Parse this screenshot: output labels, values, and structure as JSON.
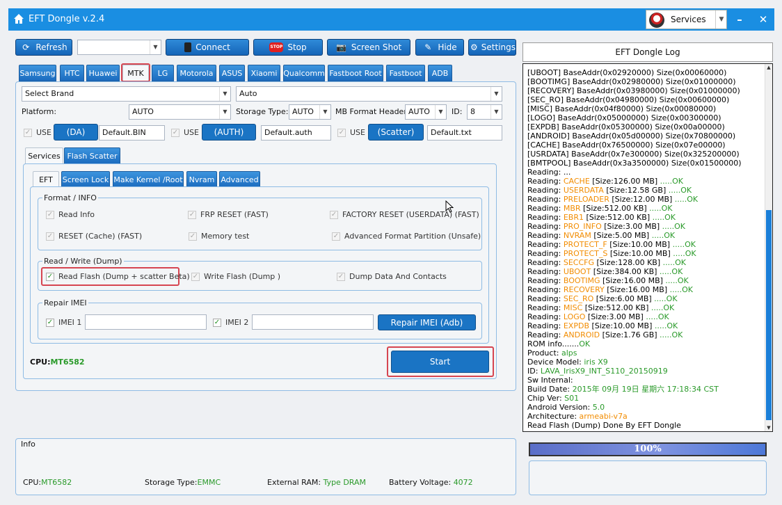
{
  "app": {
    "title": "EFT Dongle  v.2.4",
    "services_label": "Services"
  },
  "toolbar": {
    "refresh": "Refresh",
    "connect": "Connect",
    "stop": "Stop",
    "stop_badge": "STOP",
    "screenshot": "Screen Shot",
    "hide": "Hide",
    "settings": "Settings",
    "device_combo_value": ""
  },
  "brand_tabs": [
    "Samsung",
    "HTC",
    "Huawei",
    "MTK",
    "LG",
    "Motorola",
    "ASUS",
    "Xiaomi",
    "Qualcomm",
    "Fastboot Root",
    "Fastboot",
    "ADB"
  ],
  "brand_tab_selected": "MTK",
  "brand_select": "Select Brand",
  "auto_select": "Auto",
  "platform": {
    "label": "Platform:",
    "value": "AUTO"
  },
  "storage": {
    "label": "Storage Type:",
    "value": "AUTO"
  },
  "mb_format": {
    "label": "MB Format Header",
    "value": "AUTO"
  },
  "id": {
    "label": "ID:",
    "value": "8"
  },
  "use_rows": [
    {
      "use": "USE",
      "btn": "(DA)",
      "file": "Default.BIN"
    },
    {
      "use": "USE",
      "btn": "(AUTH)",
      "file": "Default.auth"
    },
    {
      "use": "USE",
      "btn": "(Scatter)",
      "file": "Default.txt"
    }
  ],
  "sub_tabs": [
    "Services",
    "Flash Scatter"
  ],
  "inner_tabs": [
    "EFT",
    "Screen Lock",
    "Make Kernel  /Root",
    "Nvram",
    "Advanced"
  ],
  "format_info": {
    "title": "Format / INFO",
    "items": [
      "Read Info",
      "FRP RESET (FAST)",
      "FACTORY RESET (USERDATA) (FAST)",
      "RESET (Cache) (FAST)",
      "Memory test",
      "Advanced Format Partition (Unsafe)"
    ]
  },
  "read_write": {
    "title": "Read / Write (Dump)",
    "items": [
      "Read Flash (Dump + scatter Beta)",
      "Write Flash (Dump )",
      "Dump Data And Contacts"
    ]
  },
  "repair_imei": {
    "title": "Repair IMEI",
    "imei1": "IMEI 1",
    "imei2": "IMEI 2",
    "imei1_value": "",
    "imei2_value": "",
    "button": "Repair IMEI (Adb)"
  },
  "cpu": {
    "label": "CPU:",
    "value": "MT6582"
  },
  "start_label": "Start",
  "info": {
    "title": "Info",
    "cpu_label": "CPU:",
    "cpu_value": "MT6582",
    "storage_label": "Storage Type:",
    "storage_value": "EMMC",
    "ram_label": "External RAM: ",
    "ram_value": "Type DRAM",
    "battery_label": "Battery Voltage: ",
    "battery_value": "4072"
  },
  "log": {
    "title": "EFT Dongle Log",
    "lines": [
      [
        {
          "t": "[UBOOT] BaseAddr(0x02920000) Size(0x00060000)",
          "c": ""
        }
      ],
      [
        {
          "t": "[BOOTIMG] BaseAddr(0x02980000) Size(0x01000000)",
          "c": ""
        }
      ],
      [
        {
          "t": "[RECOVERY] BaseAddr(0x03980000) Size(0x01000000)",
          "c": ""
        }
      ],
      [
        {
          "t": "[SEC_RO] BaseAddr(0x04980000) Size(0x00600000)",
          "c": ""
        }
      ],
      [
        {
          "t": "[MISC] BaseAddr(0x04f80000) Size(0x00080000)",
          "c": ""
        }
      ],
      [
        {
          "t": "[LOGO] BaseAddr(0x05000000) Size(0x00300000)",
          "c": ""
        }
      ],
      [
        {
          "t": "[EXPDB] BaseAddr(0x05300000) Size(0x00a00000)",
          "c": ""
        }
      ],
      [
        {
          "t": "[ANDROID] BaseAddr(0x05d00000) Size(0x70800000)",
          "c": ""
        }
      ],
      [
        {
          "t": "[CACHE] BaseAddr(0x76500000) Size(0x07e00000)",
          "c": ""
        }
      ],
      [
        {
          "t": "[USRDATA] BaseAddr(0x7e300000) Size(0x325200000)",
          "c": ""
        }
      ],
      [
        {
          "t": "[BMTPOOL] BaseAddr(0x3a3500000) Size(0x01500000)",
          "c": ""
        }
      ],
      [
        {
          "t": "Reading: ...",
          "c": ""
        }
      ],
      [
        {
          "t": "Reading: ",
          "c": ""
        },
        {
          "t": "CACHE",
          "c": "o"
        },
        {
          "t": " [Size:126.00 MB]",
          "c": ""
        },
        {
          "t": " .....OK",
          "c": "g"
        }
      ],
      [
        {
          "t": "Reading: ",
          "c": ""
        },
        {
          "t": "USERDATA",
          "c": "o"
        },
        {
          "t": " [Size:12.58 GB]",
          "c": ""
        },
        {
          "t": " .....OK",
          "c": "g"
        }
      ],
      [
        {
          "t": "Reading: ",
          "c": ""
        },
        {
          "t": "PRELOADER",
          "c": "o"
        },
        {
          "t": " [Size:12.00 MB]",
          "c": ""
        },
        {
          "t": " .....OK",
          "c": "g"
        }
      ],
      [
        {
          "t": "Reading: ",
          "c": ""
        },
        {
          "t": "MBR",
          "c": "o"
        },
        {
          "t": " [Size:512.00 KB]",
          "c": ""
        },
        {
          "t": " .....OK",
          "c": "g"
        }
      ],
      [
        {
          "t": "Reading: ",
          "c": ""
        },
        {
          "t": "EBR1",
          "c": "o"
        },
        {
          "t": " [Size:512.00 KB]",
          "c": ""
        },
        {
          "t": " .....OK",
          "c": "g"
        }
      ],
      [
        {
          "t": "Reading: ",
          "c": ""
        },
        {
          "t": "PRO_INFO",
          "c": "o"
        },
        {
          "t": " [Size:3.00 MB]",
          "c": ""
        },
        {
          "t": " .....OK",
          "c": "g"
        }
      ],
      [
        {
          "t": "Reading: ",
          "c": ""
        },
        {
          "t": "NVRAM",
          "c": "o"
        },
        {
          "t": " [Size:5.00 MB]",
          "c": ""
        },
        {
          "t": " .....OK",
          "c": "g"
        }
      ],
      [
        {
          "t": "Reading: ",
          "c": ""
        },
        {
          "t": "PROTECT_F",
          "c": "o"
        },
        {
          "t": " [Size:10.00 MB]",
          "c": ""
        },
        {
          "t": " .....OK",
          "c": "g"
        }
      ],
      [
        {
          "t": "Reading: ",
          "c": ""
        },
        {
          "t": "PROTECT_S",
          "c": "o"
        },
        {
          "t": " [Size:10.00 MB]",
          "c": ""
        },
        {
          "t": " .....OK",
          "c": "g"
        }
      ],
      [
        {
          "t": "Reading: ",
          "c": ""
        },
        {
          "t": "SECCFG",
          "c": "o"
        },
        {
          "t": " [Size:128.00 KB]",
          "c": ""
        },
        {
          "t": " .....OK",
          "c": "g"
        }
      ],
      [
        {
          "t": "Reading: ",
          "c": ""
        },
        {
          "t": "UBOOT",
          "c": "o"
        },
        {
          "t": " [Size:384.00 KB]",
          "c": ""
        },
        {
          "t": " .....OK",
          "c": "g"
        }
      ],
      [
        {
          "t": "Reading: ",
          "c": ""
        },
        {
          "t": "BOOTIMG",
          "c": "o"
        },
        {
          "t": " [Size:16.00 MB]",
          "c": ""
        },
        {
          "t": " .....OK",
          "c": "g"
        }
      ],
      [
        {
          "t": "Reading: ",
          "c": ""
        },
        {
          "t": "RECOVERY",
          "c": "o"
        },
        {
          "t": " [Size:16.00 MB]",
          "c": ""
        },
        {
          "t": " .....OK",
          "c": "g"
        }
      ],
      [
        {
          "t": "Reading: ",
          "c": ""
        },
        {
          "t": "SEC_RO",
          "c": "o"
        },
        {
          "t": " [Size:6.00 MB]",
          "c": ""
        },
        {
          "t": " .....OK",
          "c": "g"
        }
      ],
      [
        {
          "t": "Reading: ",
          "c": ""
        },
        {
          "t": "MISC",
          "c": "o"
        },
        {
          "t": " [Size:512.00 KB]",
          "c": ""
        },
        {
          "t": " .....OK",
          "c": "g"
        }
      ],
      [
        {
          "t": "Reading: ",
          "c": ""
        },
        {
          "t": "LOGO",
          "c": "o"
        },
        {
          "t": " [Size:3.00 MB]",
          "c": ""
        },
        {
          "t": " .....OK",
          "c": "g"
        }
      ],
      [
        {
          "t": "Reading: ",
          "c": ""
        },
        {
          "t": "EXPDB",
          "c": "o"
        },
        {
          "t": " [Size:10.00 MB]",
          "c": ""
        },
        {
          "t": " .....OK",
          "c": "g"
        }
      ],
      [
        {
          "t": "Reading: ",
          "c": ""
        },
        {
          "t": "ANDROID",
          "c": "o"
        },
        {
          "t": " [Size:1.76 GB]",
          "c": ""
        },
        {
          "t": " .....OK",
          "c": "g"
        }
      ],
      [
        {
          "t": "ROM info.......",
          "c": ""
        },
        {
          "t": "OK",
          "c": "g"
        }
      ],
      [
        {
          "t": "Product: ",
          "c": ""
        },
        {
          "t": "alps",
          "c": "g"
        }
      ],
      [
        {
          "t": "Device Model: ",
          "c": ""
        },
        {
          "t": "iris X9",
          "c": "g"
        }
      ],
      [
        {
          "t": "ID: ",
          "c": ""
        },
        {
          "t": "LAVA_IrisX9_INT_S110_20150919",
          "c": "g"
        }
      ],
      [
        {
          "t": "Sw Internal:",
          "c": ""
        }
      ],
      [
        {
          "t": "Build Date: ",
          "c": ""
        },
        {
          "t": "2015年 09月 19日 星期六 17:18:34 CST",
          "c": "g"
        }
      ],
      [
        {
          "t": "Chip Ver: ",
          "c": ""
        },
        {
          "t": "S01",
          "c": "g"
        }
      ],
      [
        {
          "t": "Android Version: ",
          "c": ""
        },
        {
          "t": "5.0",
          "c": "g"
        }
      ],
      [
        {
          "t": "Architecture: ",
          "c": ""
        },
        {
          "t": "armeabi-v7a",
          "c": "o"
        }
      ],
      [
        {
          "t": "Read Flash (Dump) Done By EFT Dongle",
          "c": ""
        }
      ]
    ]
  },
  "progress": {
    "value": 1.0,
    "label": "100%"
  },
  "colors": {
    "accent": "#1a8ee2",
    "ok_green": "#2a9a2a",
    "partition_orange": "#f28c00",
    "highlight_red": "#d64550"
  }
}
